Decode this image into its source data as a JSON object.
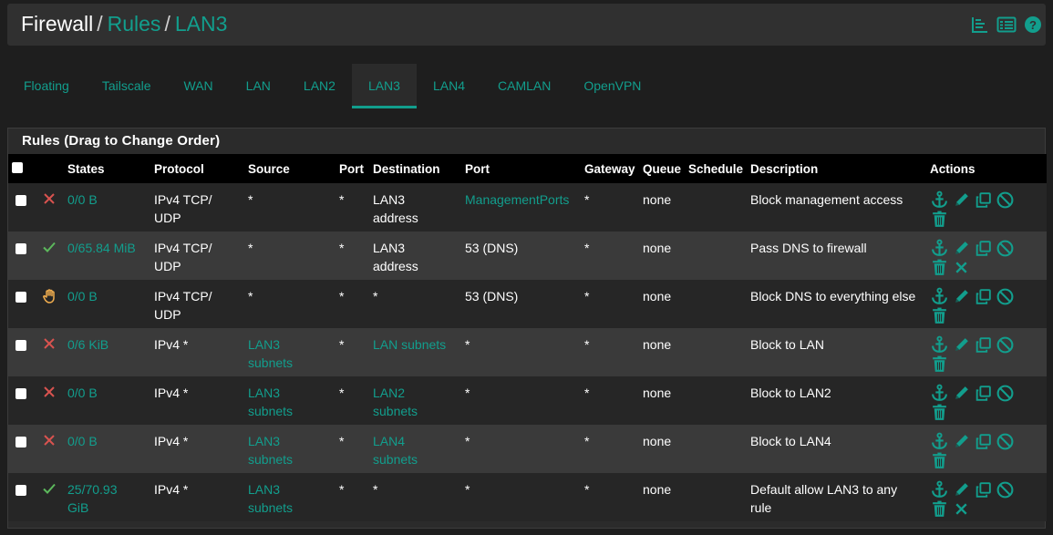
{
  "breadcrumb": {
    "root": "Firewall",
    "items": [
      "Rules",
      "LAN3"
    ],
    "separator": "/"
  },
  "header_icons": [
    "chart-icon",
    "list-icon",
    "help-icon"
  ],
  "tabs": [
    {
      "label": "Floating",
      "active": false
    },
    {
      "label": "Tailscale",
      "active": false
    },
    {
      "label": "WAN",
      "active": false
    },
    {
      "label": "LAN",
      "active": false
    },
    {
      "label": "LAN2",
      "active": false
    },
    {
      "label": "LAN3",
      "active": true
    },
    {
      "label": "LAN4",
      "active": false
    },
    {
      "label": "CAMLAN",
      "active": false
    },
    {
      "label": "OpenVPN",
      "active": false
    }
  ],
  "panel": {
    "title": "Rules (Drag to Change Order)",
    "columns": [
      "States",
      "Protocol",
      "Source",
      "Port",
      "Destination",
      "Port",
      "Gateway",
      "Queue",
      "Schedule",
      "Description",
      "Actions"
    ],
    "rows": [
      {
        "status": "block",
        "states": "0/0 B",
        "protocol": "IPv4 TCP/\nUDP",
        "source": "*",
        "source_link": false,
        "src_port": "*",
        "destination": "LAN3\naddress",
        "dest_link": false,
        "dst_port": "ManagementPorts",
        "dst_port_link": true,
        "gateway": "*",
        "queue": "none",
        "schedule": "",
        "description": "Block management access",
        "extra_action": false
      },
      {
        "status": "pass",
        "states": "0/65.84 MiB",
        "protocol": "IPv4 TCP/\nUDP",
        "source": "*",
        "source_link": false,
        "src_port": "*",
        "destination": "LAN3\naddress",
        "dest_link": false,
        "dst_port": "53 (DNS)",
        "dst_port_link": false,
        "gateway": "*",
        "queue": "none",
        "schedule": "",
        "description": "Pass DNS to firewall",
        "extra_action": true
      },
      {
        "status": "reject",
        "states": "0/0 B",
        "protocol": "IPv4 TCP/\nUDP",
        "source": "*",
        "source_link": false,
        "src_port": "*",
        "destination": "*",
        "dest_link": false,
        "dst_port": "53 (DNS)",
        "dst_port_link": false,
        "gateway": "*",
        "queue": "none",
        "schedule": "",
        "description": "Block DNS to everything else",
        "extra_action": false
      },
      {
        "status": "block",
        "states": "0/6 KiB",
        "protocol": "IPv4 *",
        "source": "LAN3\nsubnets",
        "source_link": true,
        "src_port": "*",
        "destination": "LAN subnets",
        "dest_link": true,
        "dst_port": "*",
        "dst_port_link": false,
        "gateway": "*",
        "queue": "none",
        "schedule": "",
        "description": "Block to LAN",
        "extra_action": false
      },
      {
        "status": "block",
        "states": "0/0 B",
        "protocol": "IPv4 *",
        "source": "LAN3\nsubnets",
        "source_link": true,
        "src_port": "*",
        "destination": "LAN2\nsubnets",
        "dest_link": true,
        "dst_port": "*",
        "dst_port_link": false,
        "gateway": "*",
        "queue": "none",
        "schedule": "",
        "description": "Block to LAN2",
        "extra_action": false
      },
      {
        "status": "block",
        "states": "0/0 B",
        "protocol": "IPv4 *",
        "source": "LAN3\nsubnets",
        "source_link": true,
        "src_port": "*",
        "destination": "LAN4\nsubnets",
        "dest_link": true,
        "dst_port": "*",
        "dst_port_link": false,
        "gateway": "*",
        "queue": "none",
        "schedule": "",
        "description": "Block to LAN4",
        "extra_action": false
      },
      {
        "status": "pass",
        "states": "25/70.93\nGiB",
        "protocol": "IPv4 *",
        "source": "LAN3\nsubnets",
        "source_link": true,
        "src_port": "*",
        "destination": "*",
        "dest_link": false,
        "dst_port": "*",
        "dst_port_link": false,
        "gateway": "*",
        "queue": "none",
        "schedule": "",
        "description": "Default allow LAN3 to any\nrule",
        "extra_action": true
      }
    ]
  },
  "colors": {
    "accent": "#129e8d",
    "block": "#d9534f",
    "pass": "#5cb85c",
    "reject": "#f0ad4e"
  },
  "action_icons": [
    "anchor-icon",
    "pencil-icon",
    "copy-icon",
    "ban-icon",
    "trash-icon"
  ]
}
